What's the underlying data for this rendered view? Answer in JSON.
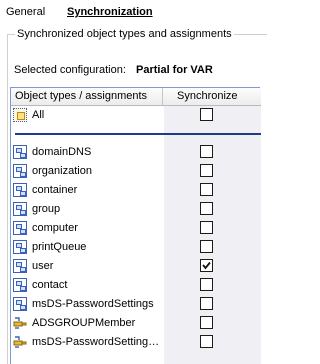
{
  "tabs": [
    {
      "label": "General",
      "active": false
    },
    {
      "label": "Synchronization",
      "active": true
    }
  ],
  "group_title": "Synchronized object types and assignments",
  "config": {
    "label": "Selected configuration:",
    "value": "Partial for VAR"
  },
  "list": {
    "columns": [
      "Object types / assignments",
      "Synchronize"
    ],
    "all_row": {
      "label": "All",
      "icon": "all-items-icon",
      "checked": false
    },
    "rows": [
      {
        "label": "domainDNS",
        "icon": "object-class-icon",
        "checked": false
      },
      {
        "label": "organization",
        "icon": "object-class-icon",
        "checked": false
      },
      {
        "label": "container",
        "icon": "object-class-icon",
        "checked": false
      },
      {
        "label": "group",
        "icon": "object-class-icon",
        "checked": false
      },
      {
        "label": "computer",
        "icon": "object-class-icon",
        "checked": false
      },
      {
        "label": "printQueue",
        "icon": "object-class-icon",
        "checked": false
      },
      {
        "label": "user",
        "icon": "object-class-icon",
        "checked": true
      },
      {
        "label": "contact",
        "icon": "object-class-icon",
        "checked": false
      },
      {
        "label": "msDS-PasswordSettings",
        "icon": "object-class-icon",
        "checked": false
      },
      {
        "label": "ADSGROUPMember",
        "icon": "assignment-icon",
        "checked": false
      },
      {
        "label": "msDS-PasswordSetting…",
        "icon": "assignment-icon",
        "checked": false
      }
    ]
  },
  "colors": {
    "accent": "#1e3c8a",
    "sync_column_bg": "#f0f0f4"
  }
}
